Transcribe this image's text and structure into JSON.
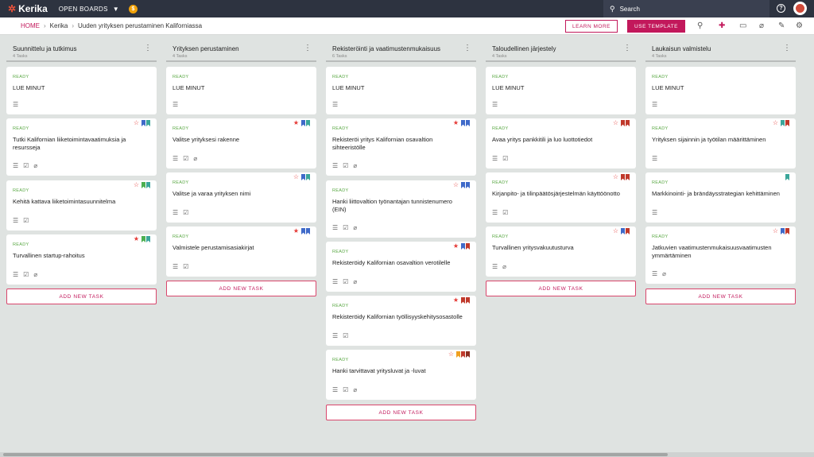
{
  "app": {
    "name": "Kerika"
  },
  "topbar": {
    "open_boards_label": "OPEN BOARDS",
    "coin_label": "$",
    "search_placeholder": "Search",
    "help_label": "?"
  },
  "breadcrumb": {
    "home": "HOME",
    "account": "Kerika",
    "board": "Uuden yrityksen perustaminen Kaliforniassa"
  },
  "actions": {
    "learn_more": "LEARN MORE",
    "use_template": "USE TEMPLATE"
  },
  "add_task_label": "ADD NEW TASK",
  "colors": {
    "accent": "#c2185b",
    "ready": "#5aa844",
    "topbar": "#2d3340",
    "star_red": "#e53935",
    "bm_blue": "#3f6ac9",
    "bm_teal": "#3aa69a",
    "bm_green": "#4caf50",
    "bm_red": "#c0392b",
    "bm_orange": "#f0a020",
    "bm_darkred": "#8b2e20"
  },
  "columns": [
    {
      "title": "Suunnittelu ja tutkimus",
      "count": "4 Tasks",
      "cards": [
        {
          "status": "READY",
          "title": "LUE MINUT"
        },
        {
          "status": "READY",
          "title": "Tutki Kalifornian liiketoimintavaatimuksia ja resursseja"
        },
        {
          "status": "READY",
          "title": "Kehitä kattava liiketoimintasuunnitelma"
        },
        {
          "status": "READY",
          "title": "Turvallinen startup-rahoitus"
        }
      ]
    },
    {
      "title": "Yrityksen perustaminen",
      "count": "4 Tasks",
      "cards": [
        {
          "status": "READY",
          "title": "LUE MINUT"
        },
        {
          "status": "READY",
          "title": "Valitse yrityksesi rakenne"
        },
        {
          "status": "READY",
          "title": "Valitse ja varaa yrityksen nimi"
        },
        {
          "status": "READY",
          "title": "Valmistele perustamisasiakirjat"
        }
      ]
    },
    {
      "title": "Rekisteröinti ja vaatimustenmukaisuus",
      "count": "6 Tasks",
      "cards": [
        {
          "status": "READY",
          "title": "LUE MINUT"
        },
        {
          "status": "READY",
          "title": "Rekisteröi yritys Kalifornian osavaltion sihteeristölle"
        },
        {
          "status": "READY",
          "title": "Hanki liittovaltion työnantajan tunnistenumero (EIN)"
        },
        {
          "status": "READY",
          "title": "Rekisteröidy Kalifornian osavaltion verotilelle"
        },
        {
          "status": "READY",
          "title": "Rekisteröidy Kalifornian työllisyyskehitysosastolle"
        },
        {
          "status": "READY",
          "title": "Hanki tarvittavat yritysluvat ja -luvat"
        }
      ]
    },
    {
      "title": "Taloudellinen järjestely",
      "count": "4 Tasks",
      "cards": [
        {
          "status": "READY",
          "title": "LUE MINUT"
        },
        {
          "status": "READY",
          "title": "Avaa yritys pankkitili ja luo luottotiedot"
        },
        {
          "status": "READY",
          "title": "Kirjanpito- ja tilinpäätösjärjestelmän käyttöönotto"
        },
        {
          "status": "READY",
          "title": "Turvallinen yritysvakuutusturva"
        }
      ]
    },
    {
      "title": "Laukaisun valmistelu",
      "count": "4 Tasks",
      "cards": [
        {
          "status": "READY",
          "title": "LUE MINUT"
        },
        {
          "status": "READY",
          "title": "Yrityksen sijainnin ja työtilan määrittäminen"
        },
        {
          "status": "READY",
          "title": "Markkinointi- ja brändäysstrategian kehittäminen"
        },
        {
          "status": "READY",
          "title": "Jatkuvien vaatimustenmukaisuusvaatimusten ymmärtäminen"
        }
      ]
    }
  ]
}
